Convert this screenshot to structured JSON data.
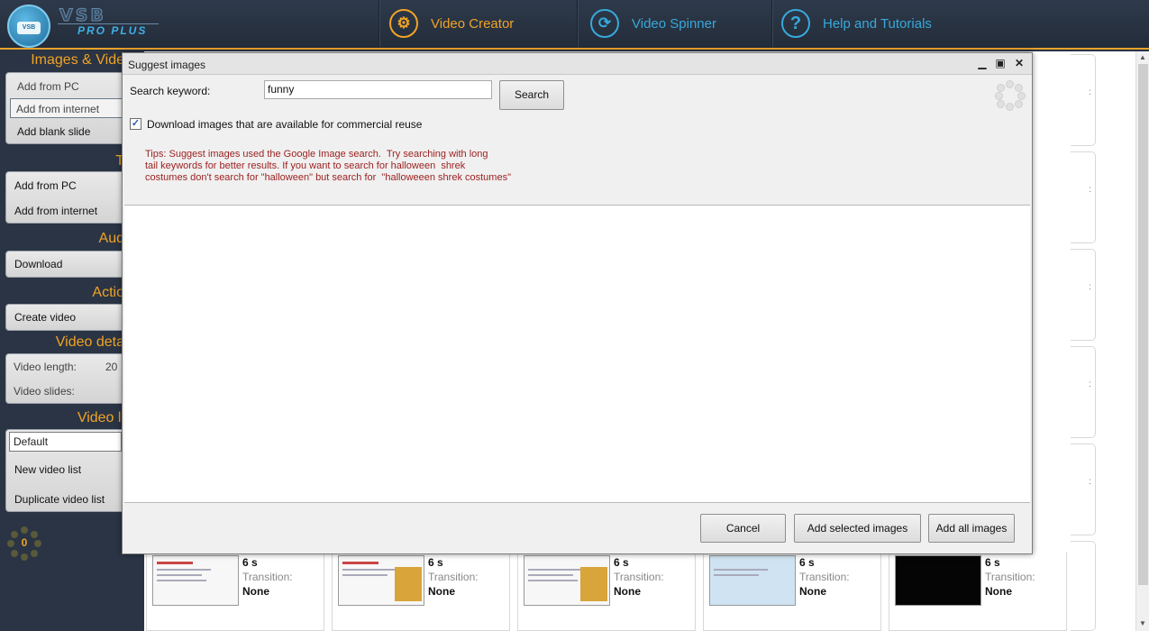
{
  "app": {
    "logo_title": "VSB",
    "logo_subtitle": "PRO PLUS",
    "logo_badge": "VSB"
  },
  "nav": [
    {
      "label": "Video Creator",
      "icon": "gear-icon"
    },
    {
      "label": "Video Spinner",
      "icon": "refresh-icon"
    },
    {
      "label": "Help and Tutorials",
      "icon": "question-icon"
    }
  ],
  "sidebar": {
    "images_title": "Images & Vide",
    "images_items": [
      "Add from PC",
      "Add from internet",
      "Add blank slide"
    ],
    "text_title": "T",
    "text_items": [
      "Add from PC",
      "Add from internet"
    ],
    "audio_title": "Aud",
    "audio_items": [
      "Download"
    ],
    "actions_title": "Actio",
    "actions_items": [
      "Create video"
    ],
    "details_title": "Video deta",
    "details": {
      "length_label": "Video length:",
      "length_value": "20",
      "slides_label": "Video slides:"
    },
    "list_title": "Video li",
    "list_select": "Default",
    "list_items": [
      "New video list",
      "Duplicate video list"
    ],
    "counter": "0"
  },
  "thumbs": [
    {
      "duration": "6 s",
      "transition_label": "Transition:",
      "transition_value": "None"
    },
    {
      "duration": "6 s",
      "transition_label": "Transition:",
      "transition_value": "None"
    },
    {
      "duration": "6 s",
      "transition_label": "Transition:",
      "transition_value": "None"
    },
    {
      "duration": "6 s",
      "transition_label": "Transition:",
      "transition_value": "None"
    },
    {
      "duration": "6 s",
      "transition_label": "Transition:",
      "transition_value": "None"
    }
  ],
  "dialog": {
    "title": "Suggest images",
    "keyword_label": "Search keyword:",
    "keyword_value": "funny",
    "search_button": "Search",
    "checkbox_checked": true,
    "checkbox_label": "Download images that are available for commercial reuse",
    "tips": "Tips: Suggest images used the Google Image search.  Try searching with long\ntail keywords for better results. If you want to search for halloween  shrek\ncostumes don't search for \"halloween\" but search for  \"halloweeen shrek costumes\"",
    "cancel_button": "Cancel",
    "add_selected_button": "Add selected images",
    "add_all_button": "Add all images"
  },
  "colors": {
    "accent_orange": "#f0a326",
    "accent_blue": "#38a9db",
    "tips_red": "#9c1e1e",
    "background": "#2a3444"
  }
}
